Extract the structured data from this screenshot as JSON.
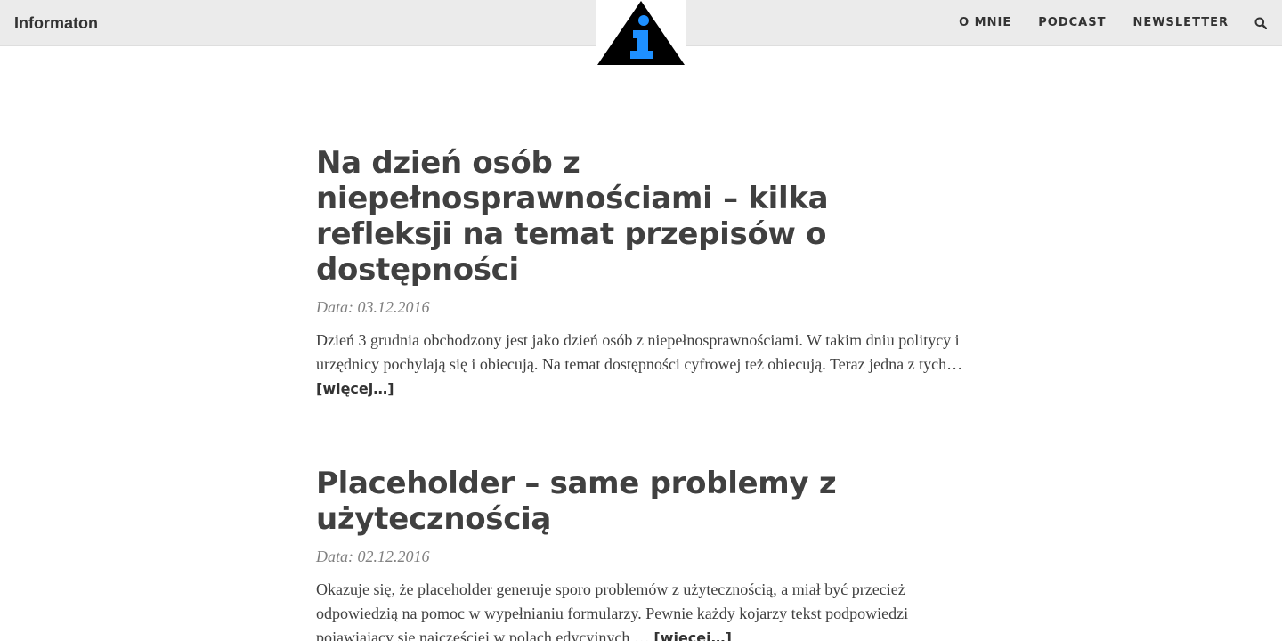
{
  "header": {
    "site_name": "Informaton",
    "nav": [
      {
        "label": "O MNIE"
      },
      {
        "label": "PODCAST"
      },
      {
        "label": "NEWSLETTER"
      }
    ],
    "search_icon": "search-icon",
    "logo_icon": "info-triangle-logo"
  },
  "colors": {
    "header_bg": "#ebebeb",
    "logo_accent": "#1e90ff",
    "text": "#404040",
    "meta": "#808080"
  },
  "posts": [
    {
      "title": "Na dzień osób z niepełnosprawnościami – kilka refleksji na temat przepisów o dostępności",
      "date": "Data: 03.12.2016",
      "excerpt": "Dzień 3 grudnia obchodzony jest jako dzień osób z niepełnosprawnościami. W takim dniu politycy i urzędnicy pochylają się i obiecują. Na temat dostępności cyfrowej też obiecują. Teraz jedna z tych…",
      "more": "[więcej…]"
    },
    {
      "title": "Placeholder – same problemy z użytecznością",
      "date": "Data: 02.12.2016",
      "excerpt": "Okazuje się, że placeholder generuje sporo problemów z użytecznością, a miał być przecież odpowiedzią na pomoc w wypełnianiu formularzy. Pewnie każdy kojarzy tekst podpowiedzi pojawiający się najczęściej w polach edycyjnych,…",
      "more": "[więcej…]"
    }
  ]
}
